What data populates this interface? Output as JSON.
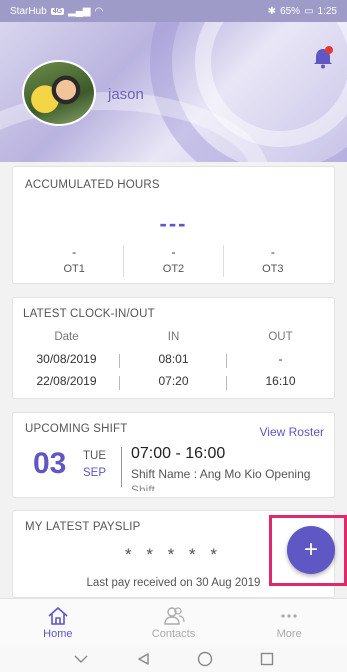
{
  "status_bar": {
    "carrier": "StarHub",
    "carrier_badge": "4G",
    "battery": "65%",
    "time": "1:25"
  },
  "header": {
    "username": "jason"
  },
  "accumulated_hours": {
    "title": "ACCUMULATED HOURS",
    "total": "---",
    "ot": [
      {
        "label": "OT1",
        "value": "-"
      },
      {
        "label": "OT2",
        "value": "-"
      },
      {
        "label": "OT3",
        "value": "-"
      }
    ]
  },
  "clock": {
    "title": "LATEST CLOCK-IN/OUT",
    "headers": [
      "Date",
      "IN",
      "OUT"
    ],
    "rows": [
      [
        "30/08/2019",
        "08:01",
        "-"
      ],
      [
        "22/08/2019",
        "07:20",
        "16:10"
      ]
    ]
  },
  "shift": {
    "title": "UPCOMING SHIFT",
    "view_roster": "View Roster",
    "day": "03",
    "dow": "TUE",
    "month": "SEP",
    "time": "07:00 - 16:00",
    "name": "Shift Name : Ang Mo Kio Opening",
    "name_overflow": "Shift"
  },
  "payslip": {
    "title": "MY LATEST PAYSLIP",
    "masked": "* * * * *",
    "last_received": "Last pay received on 30 Aug 2019"
  },
  "fab": {
    "label": "+"
  },
  "nav": {
    "items": [
      {
        "label": "Home",
        "icon": "home-icon"
      },
      {
        "label": "Contacts",
        "icon": "contacts-icon"
      },
      {
        "label": "More",
        "icon": "more-icon"
      }
    ]
  },
  "colors": {
    "accent": "#5e57c4",
    "highlight_box": "#e0286a",
    "notification_dot": "#e53935"
  }
}
